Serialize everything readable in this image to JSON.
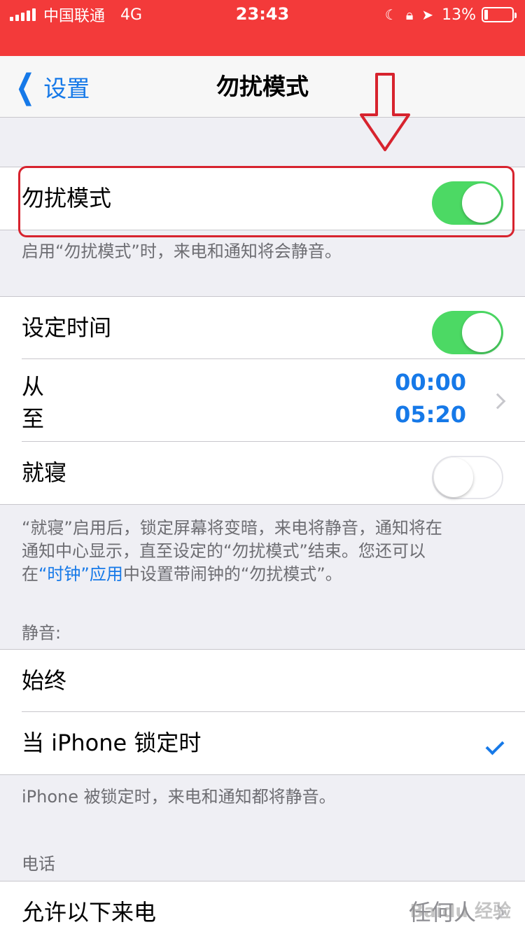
{
  "status_bar": {
    "carrier": "中国联通",
    "network": "4G",
    "time": "23:43",
    "icons": [
      "moon-icon",
      "rotation-lock-icon",
      "location-arrow-icon"
    ],
    "battery_percent_label": "13%",
    "battery_level": 0.13
  },
  "nav": {
    "back_label": "设置",
    "title": "勿扰模式"
  },
  "dnd": {
    "label": "勿扰模式",
    "enabled": true,
    "footer": "启用“勿扰模式”时，来电和通知将会静音。"
  },
  "schedule": {
    "label": "设定时间",
    "enabled": true,
    "from_label": "从",
    "to_label": "至",
    "from_time": "00:00",
    "to_time": "05:20",
    "bedtime_label": "就寝",
    "bedtime_enabled": false,
    "footer_line1": "“就寝”启用后，锁定屏幕将变暗，来电将静音，通知将在",
    "footer_line2": "通知中心显示，直至设定的“勿扰模式”结束。您还可以",
    "footer_line3_pre": "在",
    "footer_line3_link": "“时钟”应用",
    "footer_line3_post": "中设置带闹钟的“勿扰模式”。"
  },
  "silence": {
    "header": "静音:",
    "options": [
      {
        "label": "始终",
        "selected": false
      },
      {
        "label": "当 iPhone 锁定时",
        "selected": true
      }
    ],
    "footer": "iPhone 被锁定时，来电和通知都将静音。"
  },
  "phone": {
    "header": "电话",
    "allow_calls_label": "允许以下来电",
    "allow_calls_value": "任何人"
  },
  "watermark": "Baidu 经验",
  "colors": {
    "status_bar_bg": "#f33a3a",
    "accent_blue": "#1679e8",
    "toggle_green": "#4cd964",
    "annotation_red": "#d7232e"
  }
}
